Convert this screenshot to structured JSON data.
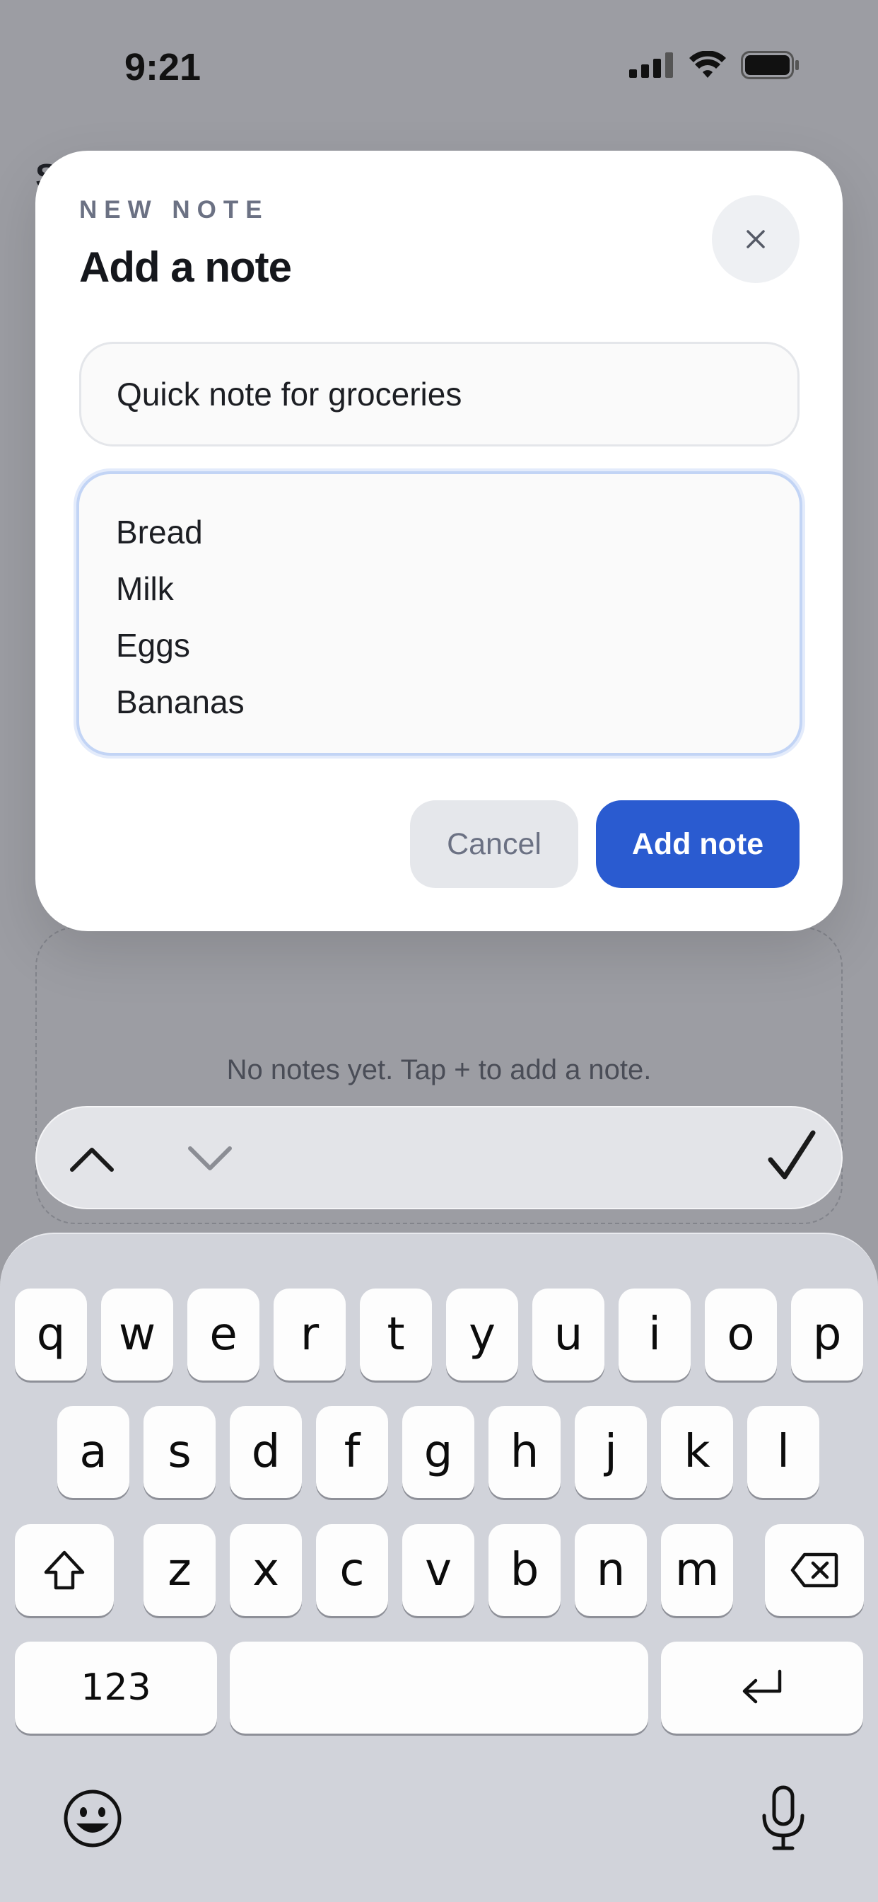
{
  "status_bar": {
    "time": "9:21"
  },
  "modal": {
    "eyebrow": "NEW NOTE",
    "title": "Add a note",
    "title_field_value": "Quick note for groceries",
    "body_field_value": "Bread\nMilk\nEggs\nBananas",
    "cancel_label": "Cancel",
    "submit_label": "Add note"
  },
  "background": {
    "empty_state_text": "No notes yet. Tap + to add a note."
  },
  "keyboard": {
    "row1": [
      "q",
      "w",
      "e",
      "r",
      "t",
      "y",
      "u",
      "i",
      "o",
      "p"
    ],
    "row2": [
      "a",
      "s",
      "d",
      "f",
      "g",
      "h",
      "j",
      "k",
      "l"
    ],
    "row3": [
      "z",
      "x",
      "c",
      "v",
      "b",
      "n",
      "m"
    ],
    "numbers_label": "123"
  },
  "colors": {
    "accent": "#2a5bd0",
    "focus_ring": "#c2d4f5"
  },
  "icons": [
    "signal-icon",
    "wifi-icon",
    "battery-icon",
    "close-icon",
    "chevron-up-icon",
    "chevron-down-icon",
    "checkmark-icon",
    "shift-icon",
    "delete-icon",
    "return-icon",
    "emoji-icon",
    "microphone-icon"
  ]
}
